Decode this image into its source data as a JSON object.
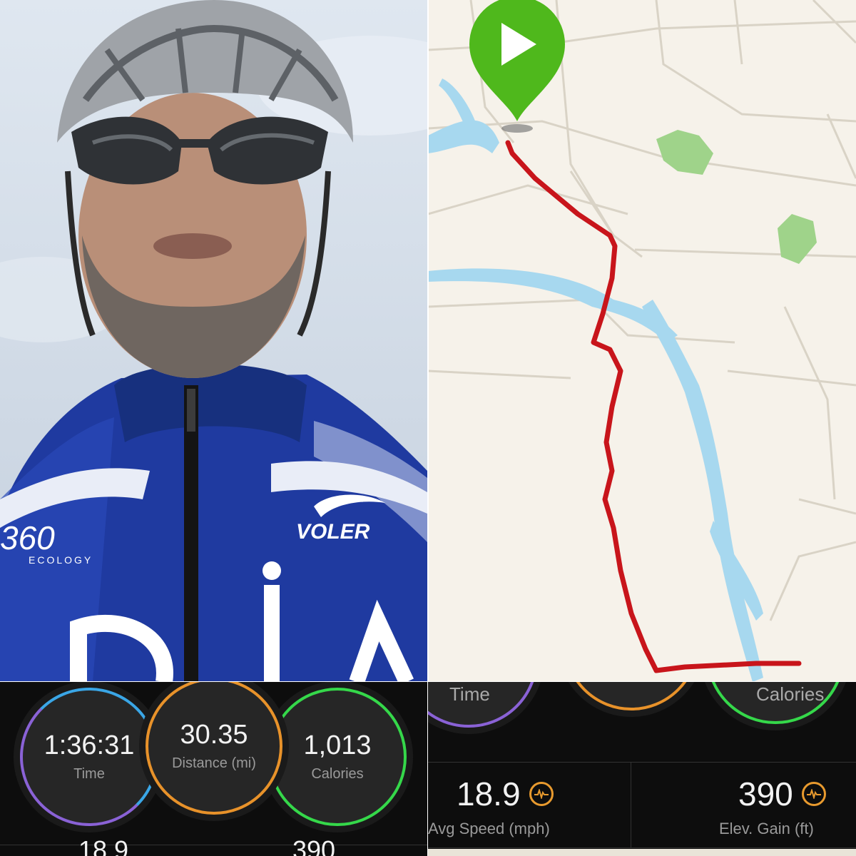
{
  "photo": {
    "jersey_logo_left": "360",
    "jersey_logo_left_sub": "ECOLOGY",
    "jersey_brand": "VOLER"
  },
  "map": {
    "start_marker": "play-icon"
  },
  "stats_left": {
    "time": {
      "value": "1:36:31",
      "label": "Time"
    },
    "distance": {
      "value": "30.35",
      "label": "Distance (mi)"
    },
    "calories": {
      "value": "1,013",
      "label": "Calories"
    },
    "bottom_partial_left": "18.9",
    "bottom_partial_right": "390"
  },
  "stats_right": {
    "time_label": "Time",
    "calories_label": "Calories",
    "avg_speed": {
      "value": "18.9",
      "label": "Avg Speed (mph)"
    },
    "elev_gain": {
      "value": "390",
      "label": "Elev. Gain (ft)"
    }
  },
  "colors": {
    "time_ring": "#3aa6e6",
    "distance_ring": "#e8922a",
    "calories_ring": "#35d84a",
    "route": "#c8151b",
    "water": "#a7d8ef",
    "park": "#9fd38a",
    "marker": "#4fb81c"
  }
}
